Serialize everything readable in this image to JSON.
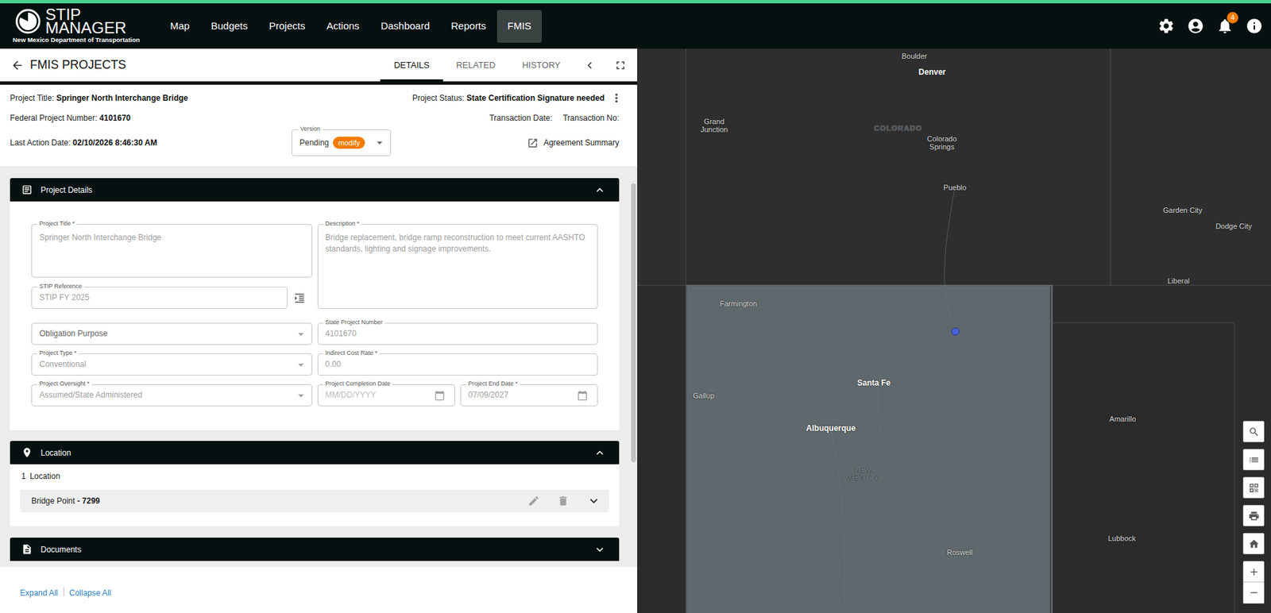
{
  "header": {
    "logo_line1": "STIP",
    "logo_line2": "MANAGER",
    "logo_subtitle": "New Mexico Department of Transportation",
    "nav": [
      {
        "label": "Map",
        "selected": false
      },
      {
        "label": "Budgets",
        "selected": false
      },
      {
        "label": "Projects",
        "selected": false
      },
      {
        "label": "Actions",
        "selected": false
      },
      {
        "label": "Dashboard",
        "selected": false
      },
      {
        "label": "Reports",
        "selected": false
      },
      {
        "label": "FMIS",
        "selected": true
      }
    ],
    "notification_count": "4"
  },
  "subheader": {
    "title": "FMIS PROJECTS",
    "tabs": [
      {
        "label": "DETAILS",
        "selected": true
      },
      {
        "label": "RELATED",
        "selected": false
      },
      {
        "label": "HISTORY",
        "selected": false
      }
    ]
  },
  "summary": {
    "project_title_label": "Project Title:",
    "project_title": "Springer North Interchange Bridge",
    "status_label": "Project Status:",
    "status": "State Certification Signature needed",
    "federal_label": "Federal Project Number:",
    "federal": "4101670",
    "transaction_date_label": "Transaction Date:",
    "transaction_no_label": "Transaction No:",
    "last_action_label": "Last Action Date:",
    "last_action": "02/10/2026 8:46:30 AM",
    "version_label": "Version",
    "version": "Pending",
    "version_badge": "modify",
    "agreement_link": "Agreement Summary"
  },
  "project_details": {
    "title": "Project Details",
    "expanded": true,
    "fields": [
      {
        "label": "Project Title *",
        "value": "Springer North Interchange Bridge",
        "kind": "textarea",
        "disabled": true
      },
      {
        "label": "Description *",
        "value": "Bridge replacement, bridge ramp reconstruction to meet current AASHTO standards, lighting and signage improvements.",
        "kind": "textarea",
        "disabled": true
      },
      {
        "label": "STIP Reference",
        "value": "STIP FY 2025",
        "kind": "text",
        "disabled": true
      },
      {
        "placeholder": "Obligation Purpose",
        "kind": "select",
        "disabled": true
      },
      {
        "label": "State Project Number",
        "value": "4101670",
        "kind": "text",
        "disabled": true
      },
      {
        "label": "Project Type *",
        "value": "Conventional",
        "kind": "select",
        "disabled": true
      },
      {
        "label": "Indirect Cost Rate *",
        "value": "0.00",
        "kind": "text",
        "disabled": true
      },
      {
        "label": "Project Oversight *",
        "value": "Assumed/State Administered",
        "kind": "select",
        "disabled": true
      },
      {
        "label": "Project Completion Date",
        "placeholder": "MM/DD/YYYY",
        "kind": "date",
        "disabled": true
      },
      {
        "label": "Project End Date *",
        "value": "07/09/2027",
        "kind": "date",
        "disabled": true
      }
    ]
  },
  "location": {
    "title": "Location",
    "expanded": true,
    "count": "1",
    "count_label": "Location",
    "items": [
      {
        "name": "Bridge Point",
        "id": " - 7299"
      }
    ]
  },
  "documents": {
    "title": "Documents",
    "expanded": false
  },
  "footer": {
    "expand_all": "Expand All",
    "collapse_all": "Collapse All"
  },
  "map": {
    "project_point": {
      "visible": true
    },
    "labels": [
      {
        "text": "Boulder",
        "kind": "city"
      },
      {
        "text": "Denver",
        "kind": "major"
      },
      {
        "text": "Grand Junction",
        "kind": "city"
      },
      {
        "text": "COLORADO",
        "kind": "state"
      },
      {
        "text": "Colorado Springs",
        "kind": "city"
      },
      {
        "text": "Pueblo",
        "kind": "city"
      },
      {
        "text": "Garden City",
        "kind": "city"
      },
      {
        "text": "Dodge City",
        "kind": "city"
      },
      {
        "text": "Liberal",
        "kind": "city"
      },
      {
        "text": "Farmington",
        "kind": "city"
      },
      {
        "text": "Santa Fe",
        "kind": "major"
      },
      {
        "text": "Gallup",
        "kind": "city"
      },
      {
        "text": "Albuquerque",
        "kind": "major"
      },
      {
        "text": "NEW MEXICO",
        "kind": "state"
      },
      {
        "text": "Amarillo",
        "kind": "city"
      },
      {
        "text": "Lubbock",
        "kind": "city"
      },
      {
        "text": "Roswell",
        "kind": "city"
      }
    ]
  }
}
